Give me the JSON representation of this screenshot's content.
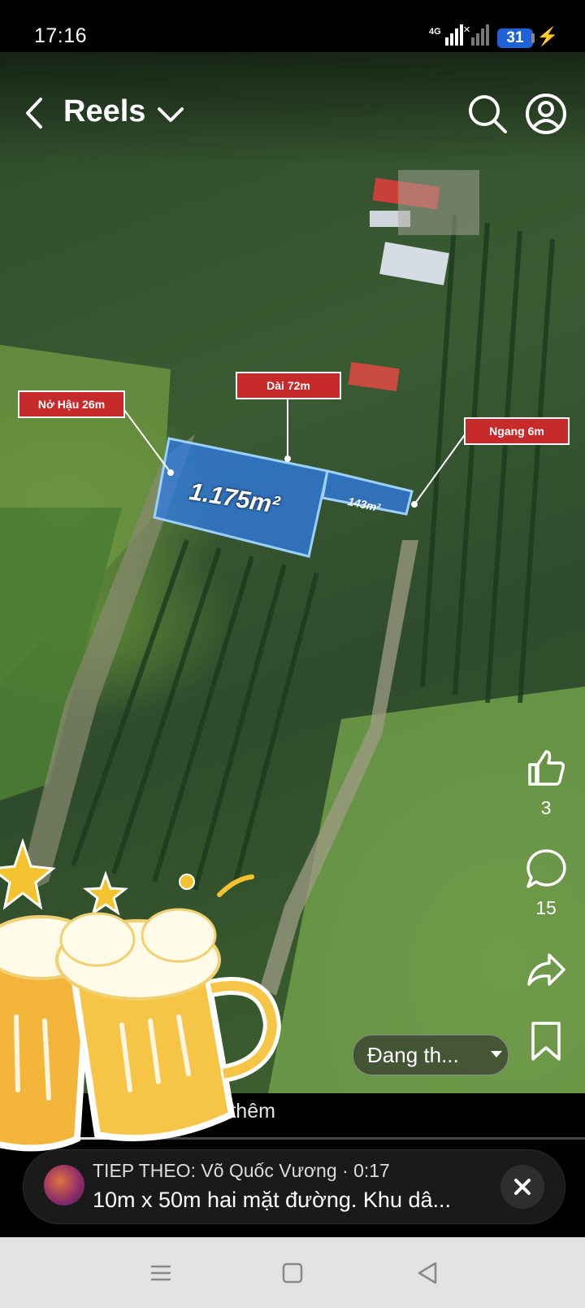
{
  "status_bar": {
    "time": "17:16",
    "network": "4G",
    "battery": "31"
  },
  "header": {
    "title": "Reels"
  },
  "plot_overlay": {
    "main_area": "1.175m²",
    "small_area": "143m²",
    "labels": {
      "back_width": "Nở Hậu 26m",
      "length": "Dài 72m",
      "front_width": "Ngang 6m"
    }
  },
  "actions": {
    "likes": "3",
    "comments": "15"
  },
  "translate": {
    "label": "Đang th..."
  },
  "caption": {
    "text": "n b       riêu... xem thêm"
  },
  "progress": {
    "fraction": 0.2
  },
  "next_up": {
    "heading": "TIEP THEO: Võ Quốc Vương · 0:17",
    "subtitle": "10m x 50m hai mặt đường. Khu dâ..."
  },
  "icons": {
    "back": "chevron-left-icon",
    "search": "search-icon",
    "profile": "profile-icon",
    "like": "thumbs-up-icon",
    "comment": "comment-icon",
    "share": "share-icon",
    "save": "bookmark-icon",
    "close": "close-icon"
  },
  "colors": {
    "label_red": "#c62a2a",
    "plot_blue": "#3a8cff",
    "battery_blue": "#1e63d6"
  }
}
